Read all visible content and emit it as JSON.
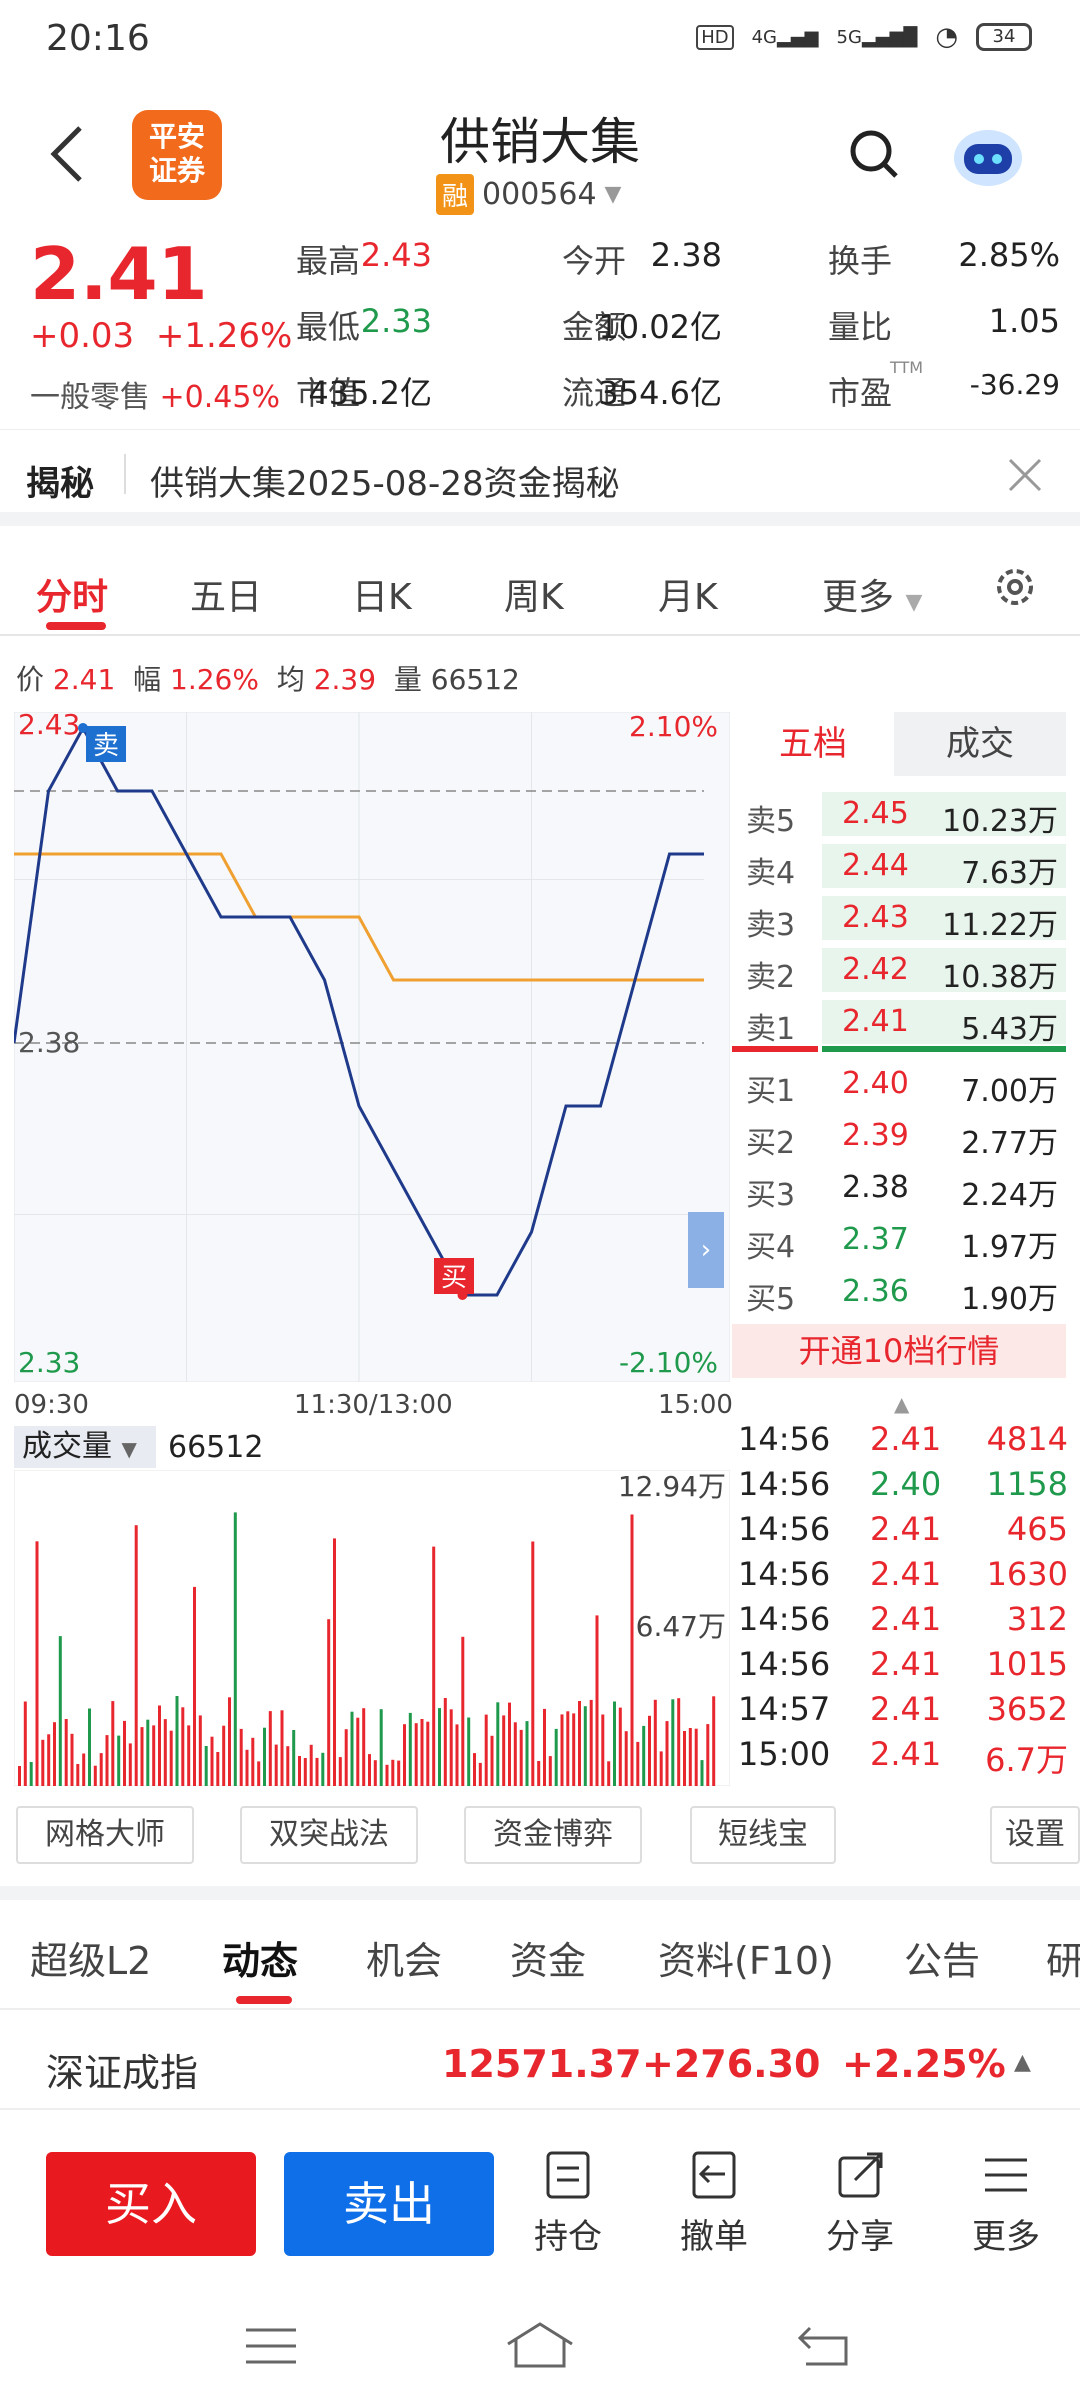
{
  "status": {
    "time": "20:16",
    "battery": "34",
    "net1": "4G",
    "net2": "5G"
  },
  "header": {
    "logo": "平安\n证券",
    "logo_l1": "平安",
    "logo_l2": "证券",
    "title": "供销大集",
    "rong": "融",
    "code": "000564"
  },
  "quote": {
    "price": "2.41",
    "change": "+0.03",
    "change_pct": "+1.26%",
    "sector_label": "一般零售",
    "sector_pct": "+0.45%",
    "cells": [
      [
        "最高",
        "2.43",
        "今开",
        "2.38",
        "换手",
        "2.85%"
      ],
      [
        "最低",
        "2.33",
        "金额",
        "10.02亿",
        "量比",
        "1.05"
      ],
      [
        "市值",
        "435.2亿",
        "流通",
        "354.6亿",
        "市盈",
        "-36.29"
      ]
    ],
    "ttm": "TTM"
  },
  "banner": {
    "label": "揭秘",
    "text": "供销大集2025-08-28资金揭秘"
  },
  "tabs": [
    "分时",
    "五日",
    "日K",
    "周K",
    "月K",
    "更多"
  ],
  "chart_info": {
    "price_l": "价",
    "price": "2.41",
    "range_l": "幅",
    "range": "1.26%",
    "avg_l": "均",
    "avg": "2.39",
    "vol_l": "量",
    "vol": "66512"
  },
  "chart_labels": {
    "ytop": "2.43",
    "ymid": "2.38",
    "ybot": "2.33",
    "pct_top": "2.10%",
    "pct_bot": "-2.10%",
    "x0": "09:30",
    "x1": "11:30/13:00",
    "x2": "15:00",
    "sell_mark": "卖",
    "buy_mark": "买"
  },
  "chart_data": {
    "type": "line",
    "x": [
      "09:30",
      "11:30/13:00",
      "15:00"
    ],
    "ylim": [
      2.33,
      2.43
    ],
    "series": [
      {
        "values": [
          2.38,
          2.42,
          2.43,
          2.42,
          2.42,
          2.41,
          2.4,
          2.4,
          2.4,
          2.39,
          2.37,
          2.36,
          2.35,
          2.34,
          2.34,
          2.35,
          2.37,
          2.37,
          2.39,
          2.41,
          2.41
        ]
      },
      {
        "values": [
          2.41,
          2.41,
          2.41,
          2.41,
          2.41,
          2.41,
          2.41,
          2.4,
          2.4,
          2.4,
          2.4,
          2.39,
          2.39,
          2.39,
          2.39,
          2.39,
          2.39,
          2.39,
          2.39,
          2.39,
          2.39
        ]
      }
    ],
    "volume_max_label": "12.94万",
    "volume_mid_label": "6.47万"
  },
  "volume": {
    "label": "成交量",
    "value": "66512"
  },
  "orderbook": {
    "tab1": "五档",
    "tab2": "成交",
    "asks": [
      [
        "卖5",
        "2.45",
        "10.23万"
      ],
      [
        "卖4",
        "2.44",
        "7.63万"
      ],
      [
        "卖3",
        "2.43",
        "11.22万"
      ],
      [
        "卖2",
        "2.42",
        "10.38万"
      ],
      [
        "卖1",
        "2.41",
        "5.43万"
      ]
    ],
    "bids": [
      [
        "买1",
        "2.40",
        "7.00万"
      ],
      [
        "买2",
        "2.39",
        "2.77万"
      ],
      [
        "买3",
        "2.38",
        "2.24万"
      ],
      [
        "买4",
        "2.37",
        "1.97万"
      ],
      [
        "买5",
        "2.36",
        "1.90万"
      ]
    ],
    "upgrade": "开通10档行情"
  },
  "trades": [
    [
      "14:56",
      "2.41",
      "4814",
      "r"
    ],
    [
      "14:56",
      "2.40",
      "1158",
      "g"
    ],
    [
      "14:56",
      "2.41",
      "465",
      "r"
    ],
    [
      "14:56",
      "2.41",
      "1630",
      "r"
    ],
    [
      "14:56",
      "2.41",
      "312",
      "r"
    ],
    [
      "14:56",
      "2.41",
      "1015",
      "r"
    ],
    [
      "14:57",
      "2.41",
      "3652",
      "r"
    ],
    [
      "15:00",
      "2.41",
      "6.7万",
      "r"
    ]
  ],
  "tools": [
    "网格大师",
    "双突战法",
    "资金博弈",
    "短线宝",
    "设置"
  ],
  "news_tabs": [
    "超级L2",
    "动态",
    "机会",
    "资金",
    "资料(F10)",
    "公告",
    "研"
  ],
  "index": {
    "name": "深证成指",
    "value": "12571.37",
    "change": "+276.30",
    "pct": "+2.25%"
  },
  "bottom": {
    "buy": "买入",
    "sell": "卖出",
    "hold": "持仓",
    "cancel": "撤单",
    "share": "分享",
    "more": "更多"
  },
  "colors": {
    "up": "#e8262d",
    "down": "#1f9a4c",
    "line": "#1f3a8a",
    "avg": "#f0a030",
    "buy_btn": "#e8191f",
    "sell_btn": "#0f6fe8"
  }
}
